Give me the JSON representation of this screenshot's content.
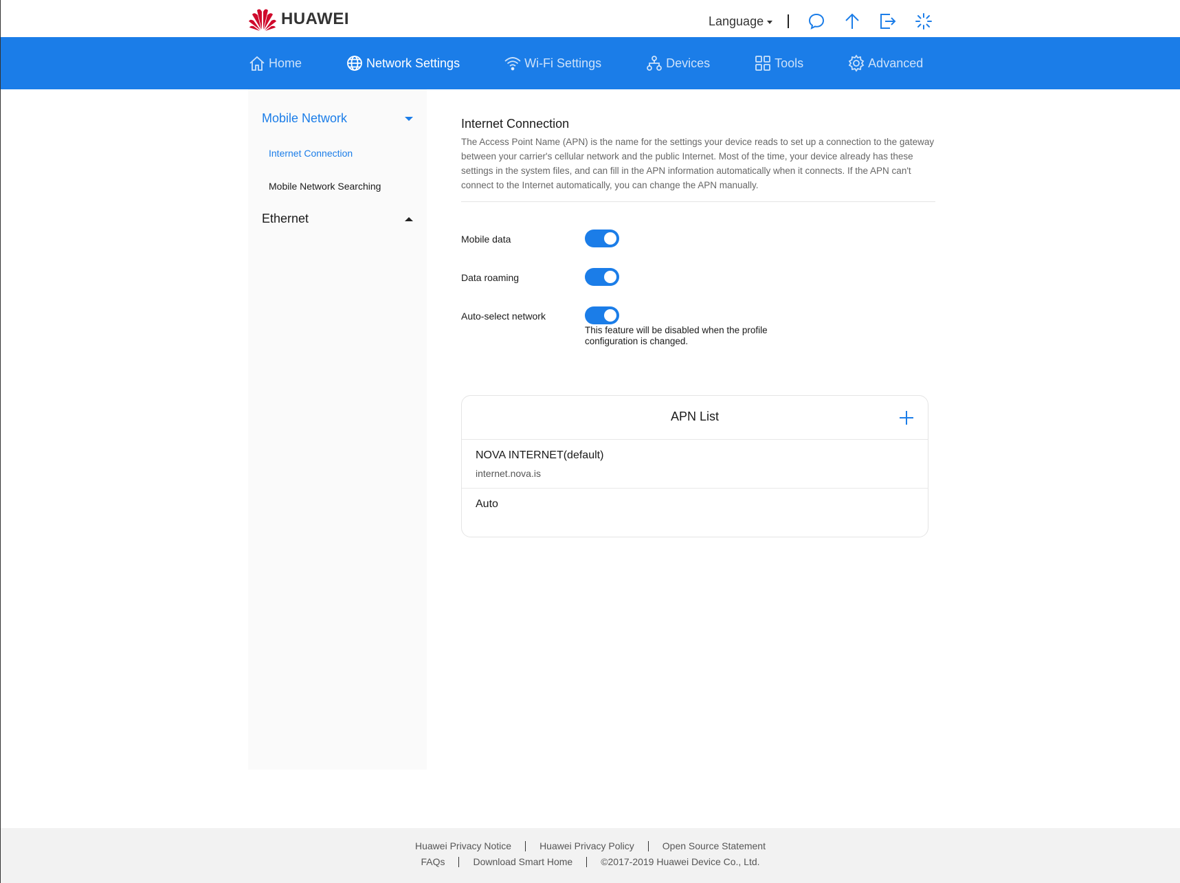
{
  "brand": {
    "name": "HUAWEI"
  },
  "header": {
    "language_label": "Language",
    "icons": [
      "chat-icon",
      "upload-icon",
      "logout-icon",
      "loading-icon"
    ]
  },
  "nav": {
    "items": [
      {
        "label": "Home",
        "icon": "home-icon",
        "active": false
      },
      {
        "label": "Network Settings",
        "icon": "globe-icon",
        "active": true
      },
      {
        "label": "Wi-Fi Settings",
        "icon": "wifi-icon",
        "active": false
      },
      {
        "label": "Devices",
        "icon": "devices-icon",
        "active": false
      },
      {
        "label": "Tools",
        "icon": "tools-icon",
        "active": false
      },
      {
        "label": "Advanced",
        "icon": "gear-icon",
        "active": false
      }
    ]
  },
  "sidebar": {
    "groups": [
      {
        "label": "Mobile Network",
        "expanded": true,
        "items": [
          {
            "label": "Internet Connection",
            "active": true
          },
          {
            "label": "Mobile Network Searching",
            "active": false
          }
        ]
      },
      {
        "label": "Ethernet",
        "expanded": false,
        "items": []
      }
    ]
  },
  "main": {
    "title": "Internet Connection",
    "description": "The Access Point Name (APN) is the name for the settings your device reads to set up a connection to the gateway between your carrier's cellular network and the public Internet. Most of the time, your device already has these settings in the system files, and can fill in the APN information automatically when it connects. If the APN can't connect to the Internet automatically, you can change the APN manually.",
    "settings": [
      {
        "label": "Mobile data",
        "enabled": true
      },
      {
        "label": "Data roaming",
        "enabled": true
      },
      {
        "label": "Auto-select network",
        "enabled": true,
        "hint": "This feature will be disabled when the profile configuration is changed."
      }
    ],
    "apn_list": {
      "title": "APN List",
      "items": [
        {
          "name": "NOVA INTERNET(default)",
          "apn": "internet.nova.is"
        },
        {
          "name": "Auto",
          "apn": ""
        }
      ]
    }
  },
  "footer": {
    "links_row1": [
      "Huawei Privacy Notice",
      "Huawei Privacy Policy",
      "Open Source Statement"
    ],
    "links_row2": [
      "FAQs",
      "Download Smart Home",
      "©2017-2019 Huawei Device Co., Ltd."
    ]
  },
  "colors": {
    "accent": "#1b7de8",
    "brand_red": "#cf0a2c"
  }
}
